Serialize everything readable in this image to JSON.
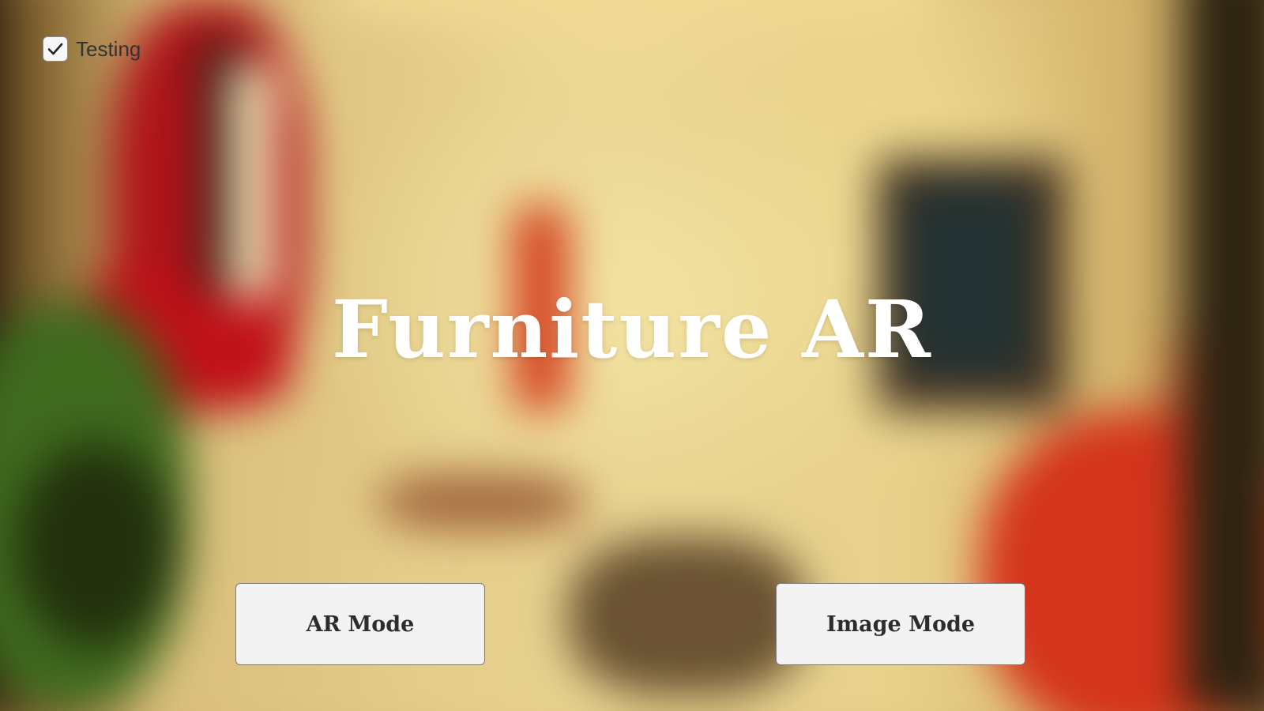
{
  "background": {
    "description_icon": "blurred-living-room-background",
    "colors": {
      "wall": "#e9d390",
      "red_accent": "#c01018",
      "plant": "#3f6a1e"
    }
  },
  "testing_toggle": {
    "label": "Testing",
    "checked": true,
    "icon": "checkmark-icon"
  },
  "title": "Furniture AR",
  "buttons": {
    "ar_mode": "AR Mode",
    "image_mode": "Image Mode"
  },
  "colors": {
    "title_text": "#ffffff",
    "button_bg": "#f3f3f3",
    "button_text": "#2d2d2d"
  }
}
